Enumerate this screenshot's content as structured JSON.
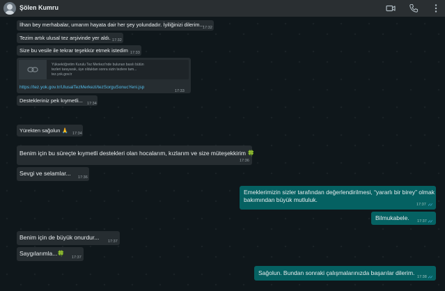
{
  "header": {
    "contact_name": "Şölen Kumru",
    "icons": [
      "avatar",
      "video-call-icon",
      "voice-call-icon"
    ]
  },
  "messages": [
    {
      "dir": "in",
      "text": "İlhan bey merhabalar, umarım hayata dair her şey yolundadır. İyiliğinizi dilerim...",
      "time": "17:32"
    },
    {
      "dir": "in",
      "text": "Tezim artık ulusal tez arşivinde yer aldı.",
      "time": "17:32"
    },
    {
      "dir": "in",
      "text": "Size bu vesile ile tekrar teşekkür etmek istedim",
      "time": "17:33"
    },
    {
      "dir": "in",
      "type": "link",
      "preview_line1": "Yükseköğretim Kurulu Tez Merkezi'nde bulunan basılı bütün",
      "preview_line2": "tezleri tarayarak, üye olduktan sonra sizin tezlere tam...",
      "preview_domain": "tez.yok.gov.tr",
      "url": "https://tez.yok.gov.tr/UlusalTezMerkezi/tezSorguSonucYeni.jsp",
      "time": "17:33"
    },
    {
      "dir": "in",
      "text": "Destekleriniz pek kıymetli...",
      "time": "17:34"
    },
    {
      "dir": "in",
      "text": "Yürekten sağolun 🙏",
      "time": "17:34"
    },
    {
      "dir": "in",
      "text": "Benim için bu süreçte kıymetli destekleri olan hocalarım, kızlarım ve size müteşekkirim 🍀",
      "time": "17:36"
    },
    {
      "dir": "in",
      "text": "Sevgi ve selamlar...",
      "time": "17:36"
    },
    {
      "dir": "out",
      "text_line1": "Emeklerimizin sizler tarafından değerlendirilmesi, “yararlı bir birey” olmak",
      "text_line2": "bakımından büyük mutluluk.",
      "time": "17:37"
    },
    {
      "dir": "out",
      "text": "Bilmukabele.",
      "time": "17:37"
    },
    {
      "dir": "in",
      "text": "Benim için de büyük onurdur...",
      "time": "17:37"
    },
    {
      "dir": "in",
      "text": "Saygılarımla...🍀",
      "time": "17:37"
    },
    {
      "dir": "out",
      "text": "Sağolun. Bundan sonraki çalışmalarınızda başarılar dilerim.",
      "time": "17:38"
    }
  ]
}
